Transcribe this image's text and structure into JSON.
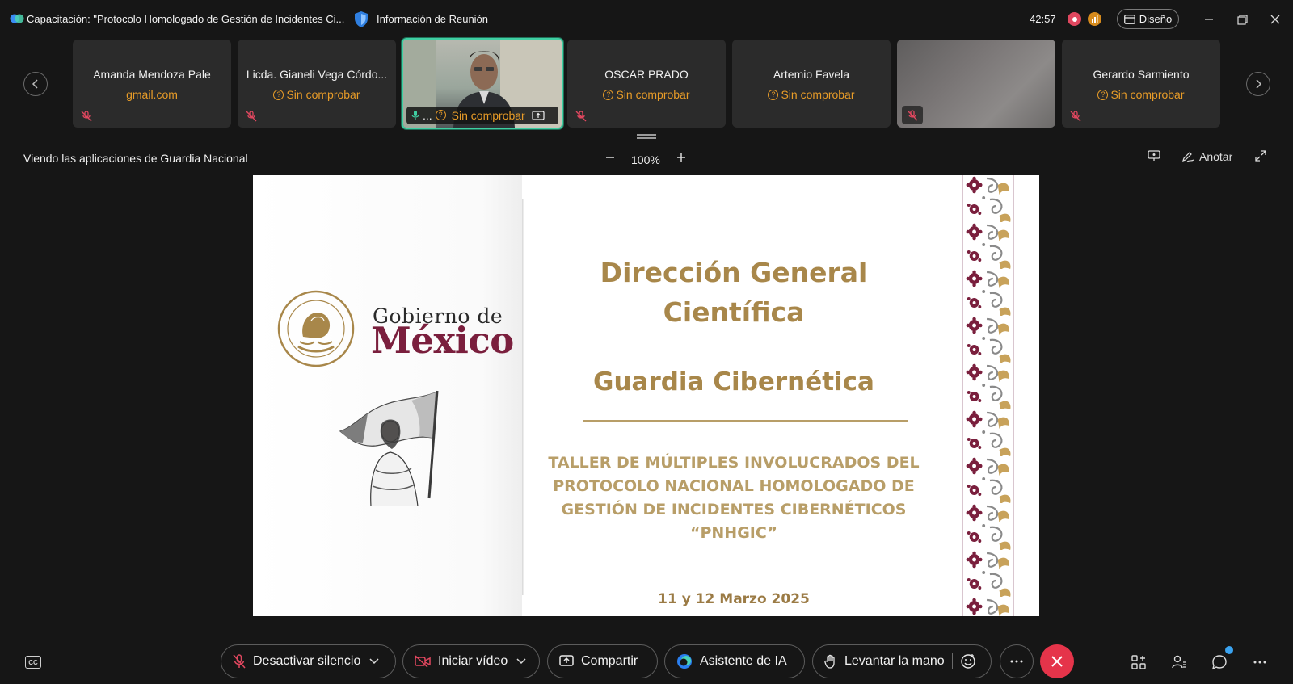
{
  "window": {
    "title": "Capacitación: \"Protocolo Homologado de Gestión de Incidentes Ci...",
    "meeting_info": "Información de Reunión",
    "timer": "42:57",
    "layout_label": "Diseño"
  },
  "participants": [
    {
      "name": "Amanda Mendoza Pale",
      "status": "gmail.com",
      "status_icon": false
    },
    {
      "name": "Licda. Gianeli Vega Córdo...",
      "status": "Sin comprobar",
      "status_icon": true
    },
    {
      "name": "...",
      "status": "Sin comprobar",
      "status_icon": true
    },
    {
      "name": "OSCAR PRADO",
      "status": "Sin comprobar",
      "status_icon": true
    },
    {
      "name": "Artemio Favela",
      "status": "Sin comprobar",
      "status_icon": true
    },
    {
      "name": "Gerardo Sarmiento",
      "status": "Sin comprobar",
      "status_icon": true
    }
  ],
  "share": {
    "viewing_text": "Viendo las aplicaciones de Guardia Nacional",
    "zoom": "100%",
    "annotate_label": "Anotar"
  },
  "slide": {
    "logo_small": "Gobierno de",
    "logo_big": "México",
    "title_line1": "Dirección General",
    "title_line2": "Científica",
    "subtitle": "Guardia Cibernética",
    "workshop_line1": "TALLER DE MÚLTIPLES INVOLUCRADOS DEL",
    "workshop_line2": "PROTOCOLO NACIONAL HOMOLOGADO DE",
    "workshop_line3": "GESTIÓN DE INCIDENTES CIBERNÉTICOS",
    "workshop_line4": "“PNHGIC”",
    "date": "11 y 12 Marzo 2025"
  },
  "controls": {
    "unmute": "Desactivar silencio",
    "start_video": "Iniciar vídeo",
    "share": "Compartir",
    "ai_assistant": "Asistente de IA",
    "raise_hand": "Levantar la mano"
  },
  "colors": {
    "accent_orange": "#e89c28",
    "video_border": "#3fcfa2",
    "leave_red": "#e5344a",
    "slide_gold": "#a8874a",
    "mexico_wine": "#7a1f3d"
  }
}
